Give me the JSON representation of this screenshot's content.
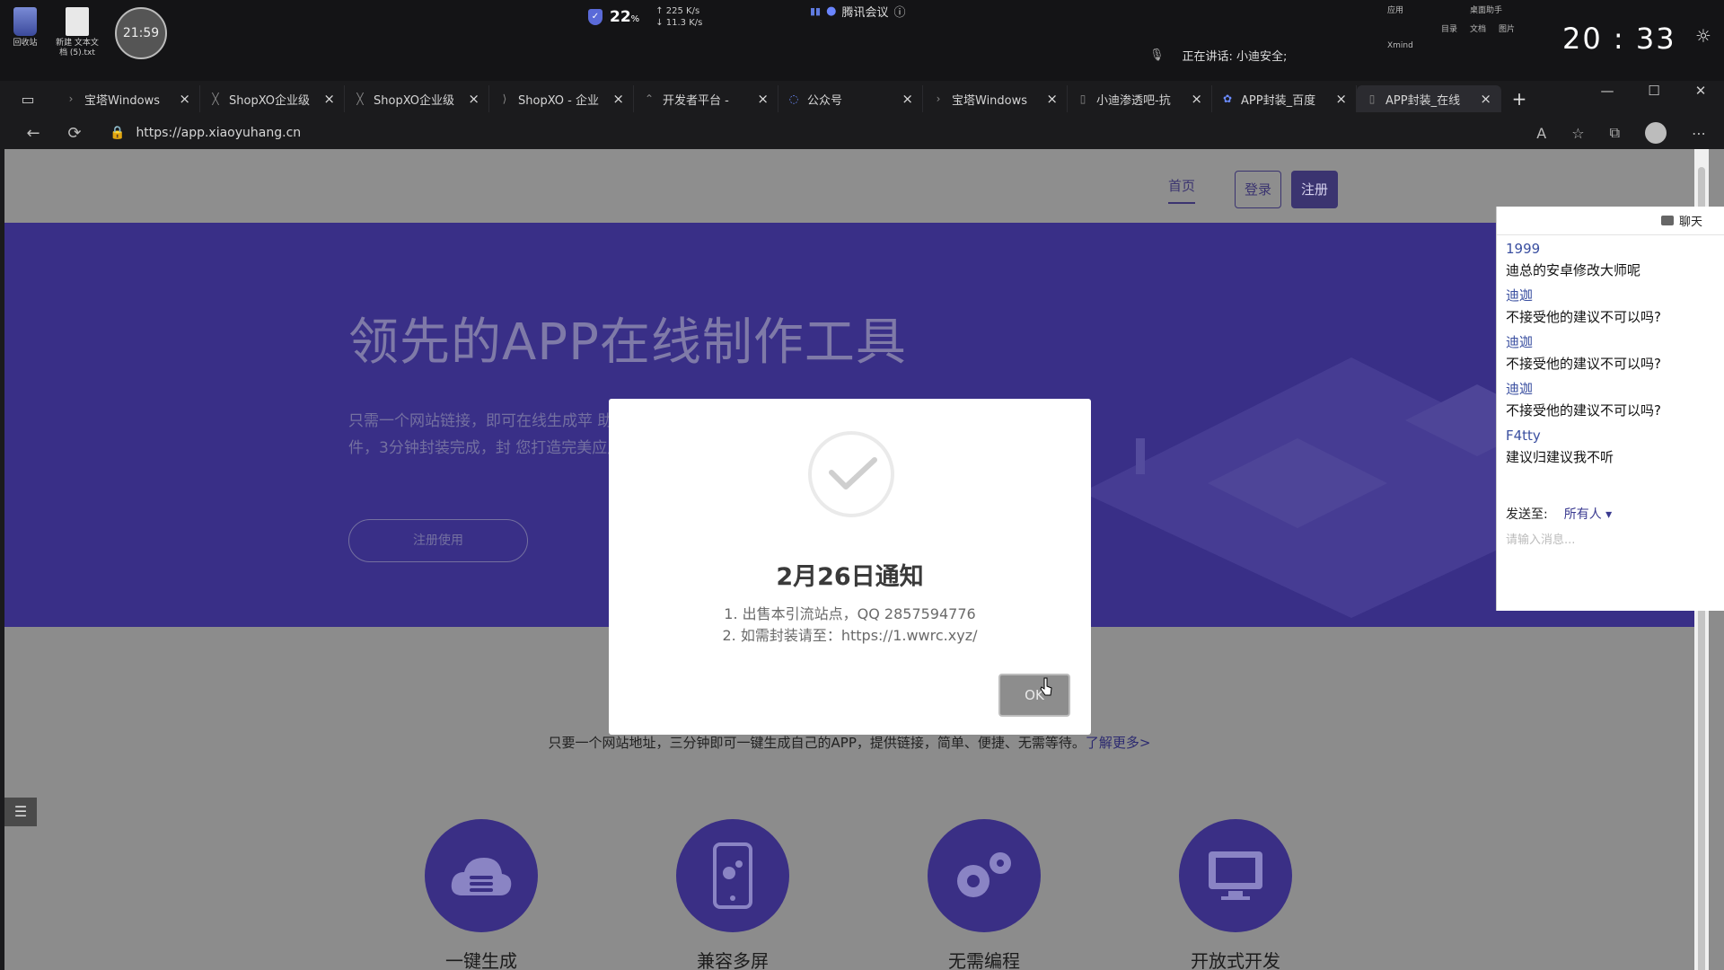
{
  "desktop": {
    "icons": [
      {
        "label": "回收站"
      },
      {
        "label": "新建 文本文档 (5).txt"
      }
    ],
    "circle_clock": "21:59",
    "perf": {
      "percent": "22",
      "unit": "%",
      "net_up": "225",
      "net_down": "11.3",
      "net_unit": "K/s"
    },
    "meeting": {
      "label": "腾讯会议"
    },
    "speaking": "正在讲话: 小迪安全;",
    "mini_tools": {
      "row1": [
        "应用",
        "桌面助手"
      ],
      "row2": [
        "目录",
        "文档",
        "图片"
      ],
      "xmind": "Xmind"
    },
    "clock": "20 : 33"
  },
  "browser": {
    "tabs": [
      {
        "label": "宝塔Windows"
      },
      {
        "label": "ShopXO企业级"
      },
      {
        "label": "ShopXO企业级"
      },
      {
        "label": "ShopXO - 企业"
      },
      {
        "label": "开发者平台 -"
      },
      {
        "label": "公众号"
      },
      {
        "label": "宝塔Windows"
      },
      {
        "label": "小迪渗透吧-抗"
      },
      {
        "label": "APP封装_百度"
      },
      {
        "label": "APP封装_在线"
      }
    ],
    "url": "https://app.xiaoyuhang.cn"
  },
  "site": {
    "nav": {
      "home": "首页",
      "login": "登录",
      "register": "注册"
    },
    "hero": {
      "title": "领先的APP在线制作工具",
      "desc": "只需一个网站链接，即可在线生成苹 助配置功能插件，3分钟封装完成，封 您打造完美应用。",
      "button": "注册使用"
    },
    "intro": {
      "text": "只要一个网站地址，三分钟即可一键生成自己的APP，提供链接，简单、便捷、无需等待。",
      "link": "了解更多>"
    },
    "features": [
      {
        "label": "一键生成",
        "icon": "cloud-icon"
      },
      {
        "label": "兼容多屏",
        "icon": "phone-gear-icon"
      },
      {
        "label": "无需编程",
        "icon": "gears-icon"
      },
      {
        "label": "开放式开发",
        "icon": "monitor-icon"
      }
    ]
  },
  "modal": {
    "title": "2月26日通知",
    "lines": [
      "1. 出售本引流站点，QQ 2857594776",
      "2. 如需封装请至：https://1.wwrc.xyz/"
    ],
    "ok": "OK"
  },
  "chat": {
    "header": "聊天",
    "messages": [
      {
        "who": "1999",
        "text": "迪总的安卓修改大师呢"
      },
      {
        "who": "迪迦",
        "text": "不接受他的建议不可以吗?"
      },
      {
        "who": "迪迦",
        "text": "不接受他的建议不可以吗?"
      },
      {
        "who": "迪迦",
        "text": "不接受他的建议不可以吗?"
      },
      {
        "who": "F4tty",
        "text": "建议归建议我不听"
      }
    ],
    "send_to_label": "发送至:",
    "send_to_value": "所有人",
    "input_placeholder": "请输入消息..."
  }
}
